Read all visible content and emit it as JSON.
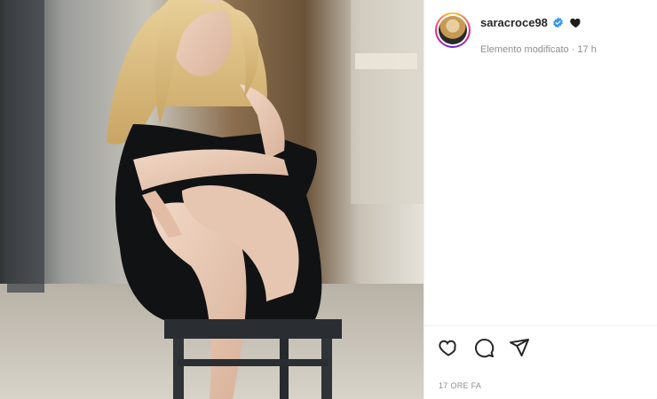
{
  "post": {
    "image_alt": "Photo of a woman with long blonde hair in a black dress sitting on a stool",
    "author": {
      "username": "saracroce98",
      "verified": true,
      "badge_icon": "black-heart-icon",
      "edit_status": "Elemento modificato · 17 h"
    },
    "actions": {
      "like_icon": "heart-outline-icon",
      "comment_icon": "comment-bubble-icon",
      "share_icon": "paper-plane-icon"
    },
    "timestamp": "17 ORE FA"
  },
  "colors": {
    "verified_blue": "#3897f0",
    "text_primary": "#262626",
    "text_secondary": "#8e8e8e",
    "border": "#efefef"
  }
}
